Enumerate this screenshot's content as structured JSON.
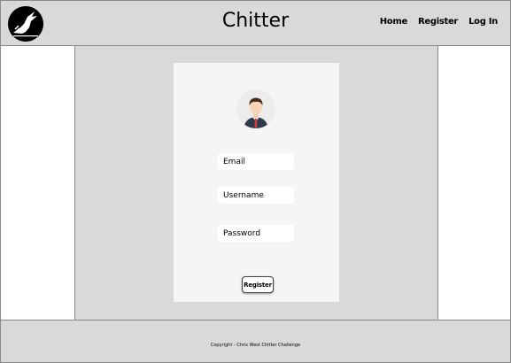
{
  "header": {
    "title": "Chitter",
    "logo_icon": "raven-logo-icon",
    "nav": [
      {
        "label": "Home"
      },
      {
        "label": "Register"
      },
      {
        "label": "Log In"
      }
    ]
  },
  "form": {
    "avatar_icon": "user-avatar-icon",
    "email_placeholder": "Email",
    "username_placeholder": "Username",
    "password_placeholder": "Password",
    "submit_label": "Register"
  },
  "footer": {
    "text": "Copyright - Chris West Chitter Challenge"
  },
  "colors": {
    "header_bg": "#d9d9d9",
    "card_bg": "#f5f5f5",
    "border": "#8a8a8a"
  }
}
